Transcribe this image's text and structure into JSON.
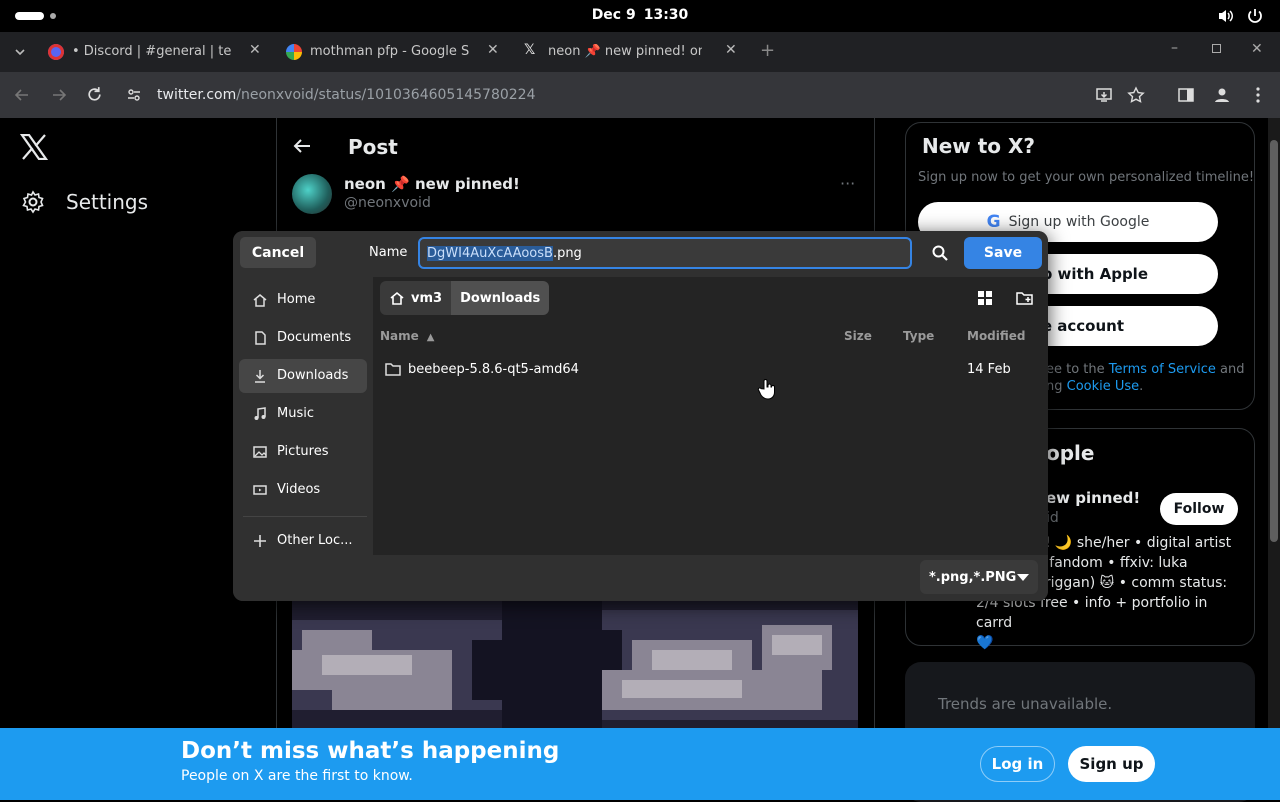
{
  "system": {
    "date": "Dec 9",
    "time": "13:30"
  },
  "tabs": [
    {
      "title": "• Discord | #general | test",
      "icon": "discord-icon"
    },
    {
      "title": "mothman pfp - Google Sear",
      "icon": "google-icon"
    },
    {
      "title": "neon 📌 new pinned! on X:",
      "icon": "x-icon"
    }
  ],
  "toolbar": {
    "url_host": "twitter.com",
    "url_path": "/neonxvoid/status/1010364605145780224"
  },
  "left_nav": {
    "settings": "Settings"
  },
  "post": {
    "header": "Post",
    "author_name": "neon 📌 new pinned!",
    "author_handle": "@neonxvoid",
    "more": "···"
  },
  "newx": {
    "title": "New to X?",
    "subtitle": "Sign up now to get your own personalized timeline!",
    "google_btn": "Sign up with Google",
    "apple_btn": "up with Apple",
    "create_btn": "te account",
    "terms_pre": "ee to the ",
    "terms_link": "Terms of Service",
    "terms_mid": " and",
    "terms_pre2": "ng ",
    "cookie_link": "Cookie Use",
    "terms_end": "."
  },
  "who": {
    "title": "ople",
    "name": "ew pinned!",
    "handle": "id",
    "follow": "Follow",
    "bio_1": "n! 🌙 she/her • digital artist",
    "bio_2": "ltifandom • ffxiv: luka",
    "bio_3": "priggan) 🐱 • comm status:",
    "bio_4": "2/4 slots free • info + portfolio in carrd",
    "bio_5": "💙"
  },
  "trends": {
    "text": "Trends are unavailable."
  },
  "bottom_bar": {
    "title": "Don’t miss what’s happening",
    "subtitle": "People on X are the first to know.",
    "login": "Log in",
    "signup": "Sign up"
  },
  "dialog": {
    "cancel": "Cancel",
    "name_label": "Name",
    "filename_selected": "DgWI4AuXcAAoosB",
    "filename_ext": ".png",
    "save": "Save",
    "places": [
      {
        "label": "Home",
        "icon": "home-icon"
      },
      {
        "label": "Documents",
        "icon": "document-icon"
      },
      {
        "label": "Downloads",
        "icon": "download-icon",
        "selected": true
      },
      {
        "label": "Music",
        "icon": "music-icon"
      },
      {
        "label": "Pictures",
        "icon": "picture-icon"
      },
      {
        "label": "Videos",
        "icon": "video-icon"
      },
      {
        "label": "Other Loc...",
        "icon": "plus-icon"
      }
    ],
    "path": [
      "vm3",
      "Downloads"
    ],
    "columns": {
      "name": "Name",
      "size": "Size",
      "type": "Type",
      "modified": "Modified"
    },
    "files": [
      {
        "name": "beebeep-5.8.6-qt5-amd64",
        "size": "",
        "type": "",
        "modified": "14 Feb"
      }
    ],
    "filter": "*.png,*.PNG"
  },
  "colors": {
    "accent": "#3584e4",
    "x_blue": "#1d9bf0"
  }
}
